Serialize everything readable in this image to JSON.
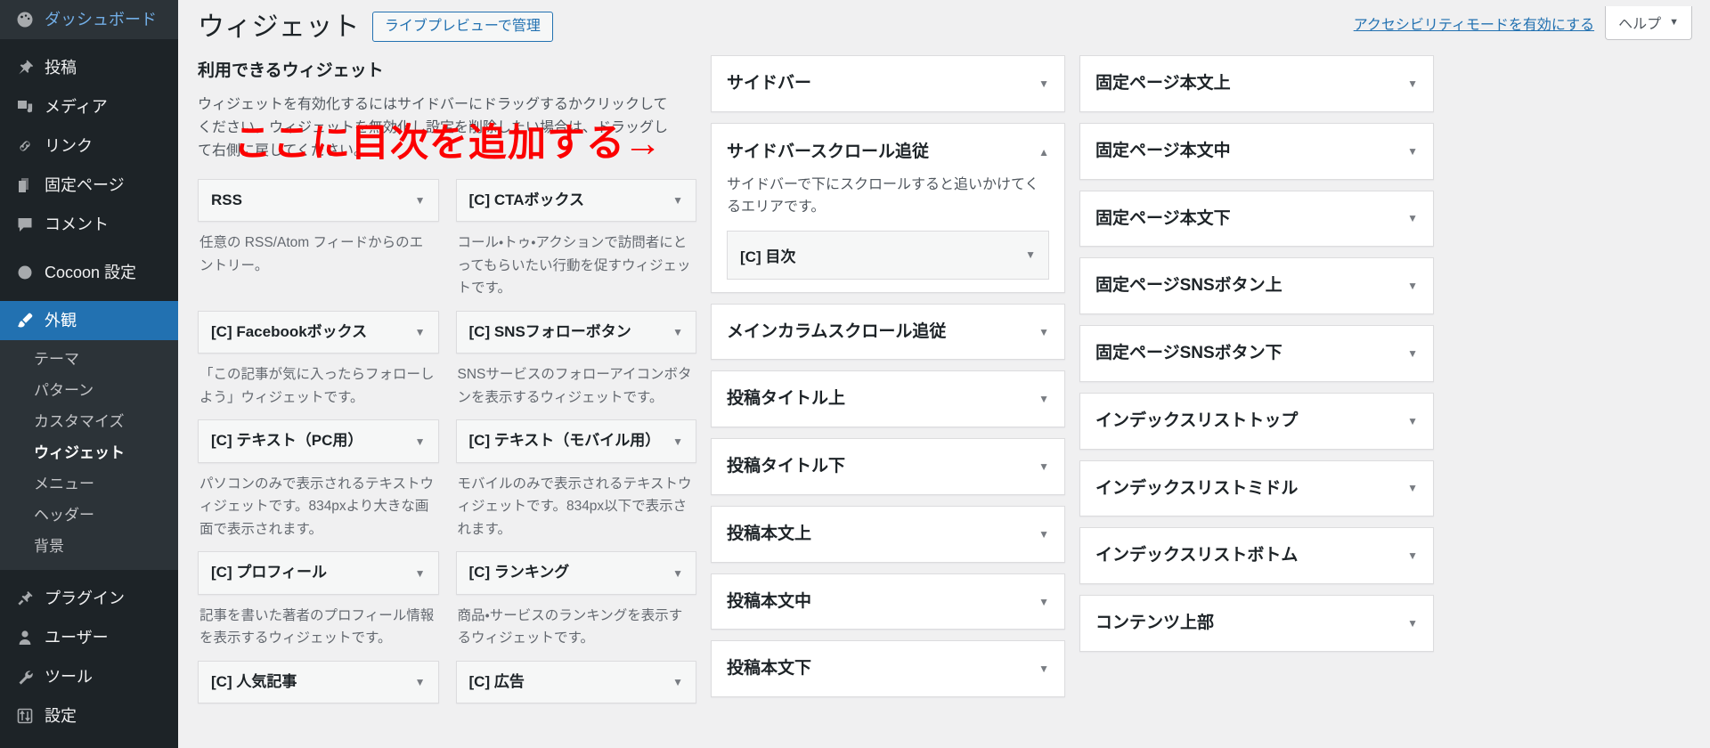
{
  "admin_menu": {
    "top_items": [
      {
        "label": "ダッシュボード",
        "icon": "dashboard-icon",
        "current": false,
        "gap_after": true
      },
      {
        "label": "投稿",
        "icon": "pin-icon",
        "current": false,
        "gap_after": false
      },
      {
        "label": "メディア",
        "icon": "media-icon",
        "current": false,
        "gap_after": false
      },
      {
        "label": "リンク",
        "icon": "link-icon",
        "current": false,
        "gap_after": false
      },
      {
        "label": "固定ページ",
        "icon": "pages-icon",
        "current": false,
        "gap_after": false
      },
      {
        "label": "コメント",
        "icon": "comment-icon",
        "current": false,
        "gap_after": true
      },
      {
        "label": "Cocoon 設定",
        "icon": "cocoon-icon",
        "current": false,
        "gap_after": true
      }
    ],
    "appearance": {
      "label": "外観",
      "icon": "brush-icon",
      "current": true
    },
    "appearance_submenu": [
      {
        "label": "テーマ",
        "current": false
      },
      {
        "label": "パターン",
        "current": false
      },
      {
        "label": "カスタマイズ",
        "current": false
      },
      {
        "label": "ウィジェット",
        "current": true
      },
      {
        "label": "メニュー",
        "current": false
      },
      {
        "label": "ヘッダー",
        "current": false
      },
      {
        "label": "背景",
        "current": false
      }
    ],
    "bottom_items": [
      {
        "label": "プラグイン",
        "icon": "plugin-icon"
      },
      {
        "label": "ユーザー",
        "icon": "user-icon"
      },
      {
        "label": "ツール",
        "icon": "wrench-icon"
      },
      {
        "label": "設定",
        "icon": "settings-icon"
      }
    ]
  },
  "screen_meta": {
    "accessibility_link": "アクセシビリティモードを有効にする",
    "help_label": "ヘルプ",
    "help_caret": "▼"
  },
  "header": {
    "title": "ウィジェット",
    "live_preview_button": "ライブプレビューで管理"
  },
  "annotation": {
    "text": "ここに目次を追加する",
    "arrow": "→",
    "color": "#fc0000"
  },
  "available": {
    "heading": "利用できるウィジェット",
    "description": "ウィジェットを有効化するにはサイドバーにドラッグするかクリックしてください。ウィジェットを無効化し設定を削除したい場合は、ドラッグして右側に戻してください。",
    "caret": "▼",
    "widgets": [
      {
        "name": "RSS",
        "desc": "任意の RSS/Atom フィードからのエントリー。"
      },
      {
        "name": "[C] CTAボックス",
        "desc": "コール・トゥ・アクションで訪問者にとってもらいたい行動を促すウィジェットです。"
      },
      {
        "name": "[C] Facebookボックス",
        "desc": "「この記事が気に入ったらフォローしよう」ウィジェットです。"
      },
      {
        "name": "[C] SNSフォローボタン",
        "desc": "SNSサービスのフォローアイコンボタンを表示するウィジェットです。"
      },
      {
        "name": "[C] テキスト（PC用）",
        "desc": "パソコンのみで表示されるテキストウィジェットです。834pxより大きな画面で表示されます。"
      },
      {
        "name": "[C] テキスト（モバイル用）",
        "desc": "モバイルのみで表示されるテキストウィジェットです。834px以下で表示されます。"
      },
      {
        "name": "[C] プロフィール",
        "desc": "記事を書いた著者のプロフィール情報を表示するウィジェットです。"
      },
      {
        "name": "[C] ランキング",
        "desc": "商品・サービスのランキングを表示するウィジェットです。"
      },
      {
        "name": "[C] 人気記事",
        "desc": ""
      },
      {
        "name": "[C] 広告",
        "desc": ""
      }
    ]
  },
  "areas_middle": {
    "caret_closed": "▼",
    "caret_open": "▲",
    "panels": [
      {
        "name": "サイドバー",
        "open": false,
        "desc": "",
        "widgets": []
      },
      {
        "name": "サイドバースクロール追従",
        "open": true,
        "desc": "サイドバーで下にスクロールすると追いかけてくるエリアです。",
        "widgets": [
          {
            "name": "[C] 目次"
          }
        ]
      },
      {
        "name": "メインカラムスクロール追従",
        "open": false,
        "desc": "",
        "widgets": []
      },
      {
        "name": "投稿タイトル上",
        "open": false,
        "desc": "",
        "widgets": []
      },
      {
        "name": "投稿タイトル下",
        "open": false,
        "desc": "",
        "widgets": []
      },
      {
        "name": "投稿本文上",
        "open": false,
        "desc": "",
        "widgets": []
      },
      {
        "name": "投稿本文中",
        "open": false,
        "desc": "",
        "widgets": []
      },
      {
        "name": "投稿本文下",
        "open": false,
        "desc": "",
        "widgets": []
      }
    ]
  },
  "areas_right": {
    "caret_closed": "▼",
    "panels": [
      {
        "name": "固定ページ本文上"
      },
      {
        "name": "固定ページ本文中"
      },
      {
        "name": "固定ページ本文下"
      },
      {
        "name": "固定ページSNSボタン上"
      },
      {
        "name": "固定ページSNSボタン下"
      },
      {
        "name": "インデックスリストトップ"
      },
      {
        "name": "インデックスリストミドル"
      },
      {
        "name": "インデックスリストボトム"
      },
      {
        "name": "コンテンツ上部"
      }
    ]
  }
}
